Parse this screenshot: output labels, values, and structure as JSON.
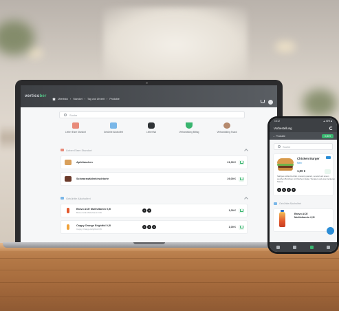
{
  "laptop": {
    "logo": {
      "part1": "vertics",
      "part2": "ber"
    },
    "breadcrumb": [
      "Überblick",
      "Standort",
      "Tag und Uhrzeit",
      "Produkte"
    ],
    "search_placeholder": "Suche",
    "categories": [
      {
        "label": "Lieber Eiser Standort",
        "color": "#e88b7a",
        "icon": "store-icon"
      },
      {
        "label": "Gekühlte Alkoholfrei",
        "color": "#7ab7e8",
        "icon": "bottle-icon"
      },
      {
        "label": "Lieberthai",
        "color": "#2f3336",
        "icon": "bag-icon"
      },
      {
        "label": "Verbandsking Mittag",
        "color": "#39b56f",
        "icon": "bowl-icon"
      },
      {
        "label": "Verbandsking Snack",
        "color": "#b58a6e",
        "icon": "snack-icon"
      }
    ],
    "sections": [
      {
        "title": "Lieber Eiser Standort",
        "color": "#e88b7a",
        "items": [
          {
            "name": "Apfeltaschen",
            "sub": "",
            "price": "21,00 €",
            "color": "#d9a05b",
            "allergens": []
          },
          {
            "name": "Schwarzwälderkirschtorte",
            "sub": "",
            "price": "29,00 €",
            "color": "#6b3a2a",
            "allergens": []
          }
        ]
      },
      {
        "title": "Gekühlte Alkoholfrei",
        "color": "#7ab7e8",
        "items": [
          {
            "name": "Bravo ACE Multivitamin 0,5l",
            "sub": "Bravo ACE Multivitamin 0,5l",
            "price": "1,00 €",
            "color": "#e3582c",
            "allergens": [
              "✔",
              "3"
            ]
          },
          {
            "name": "Cappy Orange Erightfol 0,5l",
            "sub": "Cappy Orange Erightfol 0,5l",
            "price": "1,00 €",
            "color": "#f0a23a",
            "allergens": [
              "2",
              "3",
              "4"
            ]
          }
        ]
      }
    ]
  },
  "phone": {
    "status": {
      "time": "16:12",
      "right": "▲ 46% ■"
    },
    "app_title": "Vorbestellung",
    "back_label": "Produkte",
    "cart_label": "0,00 €",
    "search_placeholder": "Suche",
    "featured": {
      "title": "Chicken Burger",
      "info": "Mehr",
      "price": "1,00 €",
      "description": "Saftiges Hähnchenfilet, knusprig paniert, serviert auf einem weichen Brötchen mit frischem Salat, Tomaten und einer leckeren Sauce.",
      "allergens": [
        "A",
        "G",
        "C",
        "♥"
      ]
    },
    "section_title": "Gekühlte Alkoholfrei",
    "second_item": {
      "name_line1": "Bravo ACE",
      "name_line2": "Multivitamin 0,5l"
    }
  }
}
